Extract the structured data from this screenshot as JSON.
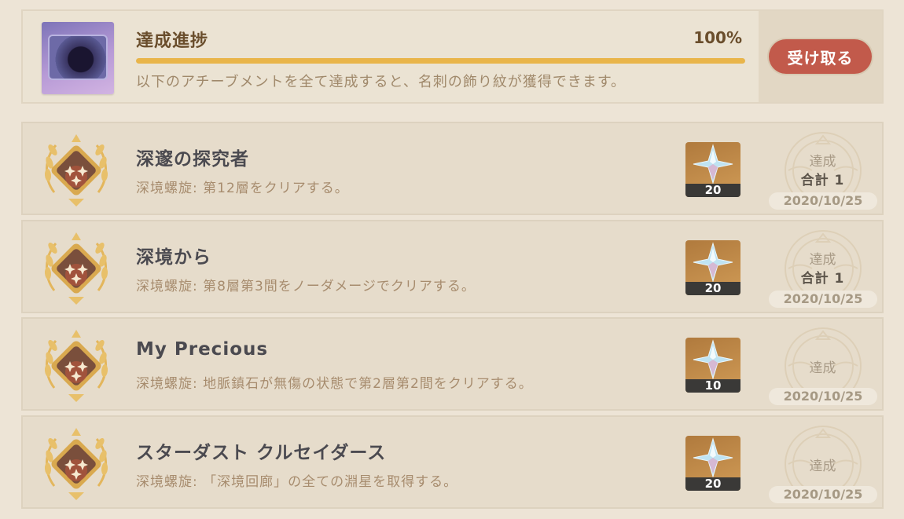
{
  "header": {
    "title": "達成進捗",
    "progress_text": "100%",
    "progress": 1.0,
    "description": "以下のアチーブメントを全て達成すると、名刺の飾り紋が獲得できます。",
    "claim_label": "受け取る"
  },
  "achievements": [
    {
      "title": "深邃の探究者",
      "description": "深境螺旋: 第12層をクリアする。",
      "reward_icon": "primogem-icon",
      "reward_count": "20",
      "status_label": "達成",
      "total": "合計 1",
      "date": "2020/10/25"
    },
    {
      "title": "深境から",
      "description": "深境螺旋: 第8層第3間をノーダメージでクリアする。",
      "reward_icon": "primogem-icon",
      "reward_count": "20",
      "status_label": "達成",
      "total": "合計 1",
      "date": "2020/10/25"
    },
    {
      "title": "My Precious",
      "description": "深境螺旋: 地脈鎮石が無傷の状態で第2層第2間をクリアする。",
      "reward_icon": "primogem-icon",
      "reward_count": "10",
      "status_label": "達成",
      "date": "2020/10/25"
    },
    {
      "title": "スターダスト クルセイダース",
      "description": "深境螺旋: 「深境回廊」の全ての淵星を取得する。",
      "reward_icon": "primogem-icon",
      "reward_count": "20",
      "status_label": "達成",
      "date": "2020/10/25"
    }
  ],
  "colors": {
    "background": "#ede4d6",
    "accent": "#e9b54a",
    "claim_button": "#c25a4b"
  }
}
